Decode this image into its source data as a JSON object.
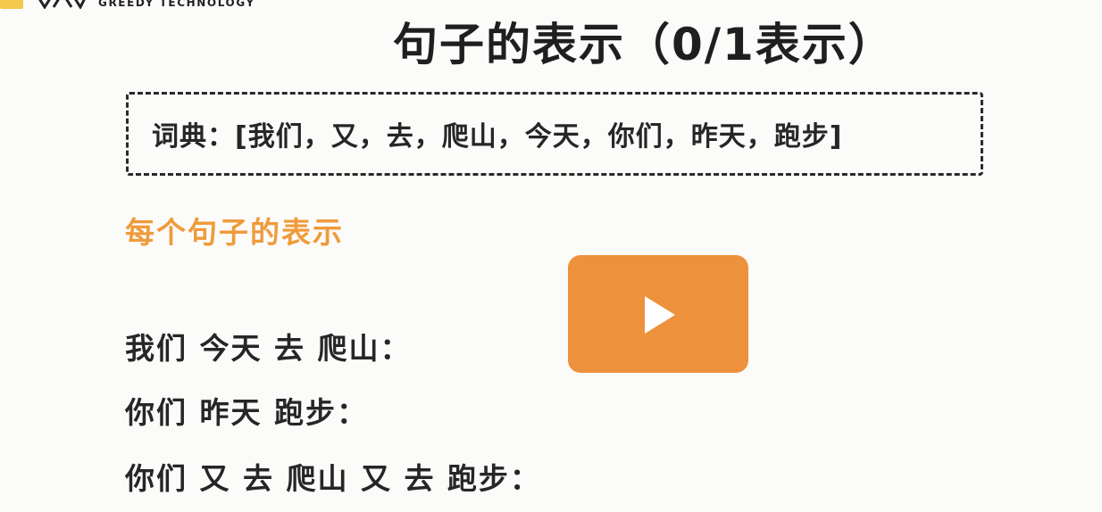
{
  "header": {
    "brand_text": "GREEDY TECHNOLOGY",
    "brand_color": "#f2c94c",
    "logo_icon": "greedy-logo-icon"
  },
  "slide": {
    "title": "句子的表示（0/1表示）",
    "dictionary_line": "词典：[我们，又，去，爬山，今天，你们，昨天，跑步]",
    "subtitle": "每个句子的表示",
    "subtitle_color": "#ef9b3b",
    "sentences": [
      "我们 今天 去 爬山：",
      "你们 昨天 跑步：",
      "你们 又 去 爬山 又 去 跑步："
    ]
  },
  "player": {
    "play_icon": "play-icon",
    "accent_color": "#ee913c"
  }
}
